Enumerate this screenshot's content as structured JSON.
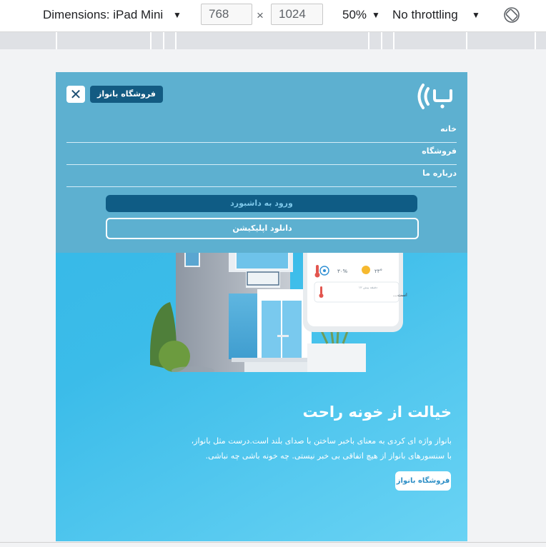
{
  "devtools": {
    "dimensions_label": "Dimensions: iPad Mini",
    "width_value": "768",
    "height_value": "1024",
    "times": "×",
    "zoom": "50%",
    "throttling": "No throttling"
  },
  "page": {
    "top_store_button": "فروشگاه بانواز",
    "close": "✕",
    "nav": [
      "خانه",
      "فروشگاه",
      "درباره ما"
    ],
    "dashboard_button": "ورود به داشبورد",
    "app_button": "دانلود اپلیکیشن",
    "phone_weather": {
      "temp": "۲۳°",
      "hum": "۳۰%",
      "notif_time": "۱۲ دقیقه پیش",
      "notif_text": "دما در حال افزایش است..."
    },
    "hero_title": "خیالت از خونه راحت",
    "hero_line1": "بانواز واژه ای کردی به معنای باخبر ساختن با صدای بلند است.درست مثل بانواز،",
    "hero_line2": "با سنسورهای بانواز از هیچ اتفاقی بی خبر نیستی. چه خونه باشی چه نباشی.",
    "hero_store_button": "فروشگاه بانواز"
  },
  "colors": {
    "menu_panel": "#5db0d0",
    "dark_button": "#0f5c85",
    "hero_gradient_start": "#34b6e6",
    "hero_gradient_end": "#6ad3f4"
  }
}
